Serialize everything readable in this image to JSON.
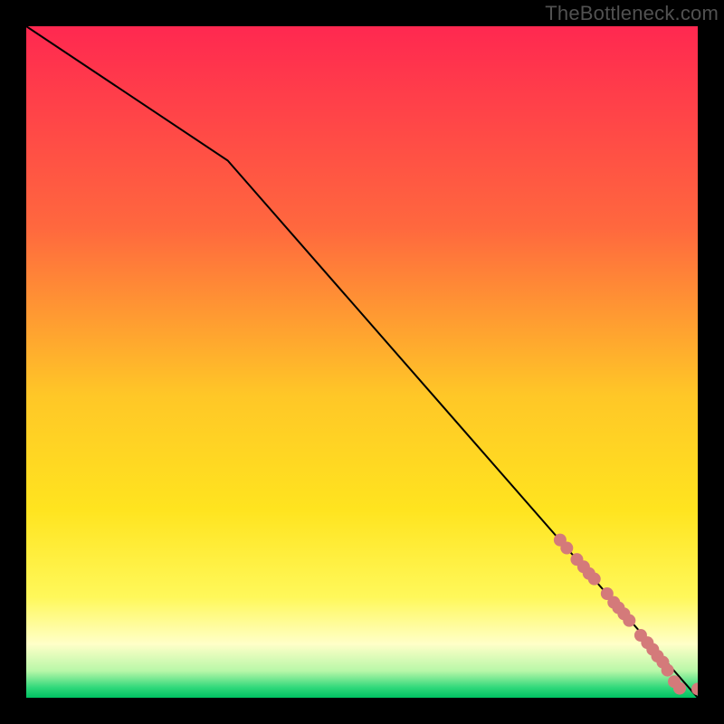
{
  "watermark": "TheBottleneck.com",
  "chart_data": {
    "type": "line",
    "title": "",
    "xlabel": "",
    "ylabel": "",
    "xlim": [
      0,
      100
    ],
    "ylim": [
      0,
      100
    ],
    "background_gradient_stops": [
      {
        "offset": 0.0,
        "color": "#ff2850"
      },
      {
        "offset": 0.3,
        "color": "#ff683e"
      },
      {
        "offset": 0.55,
        "color": "#ffc727"
      },
      {
        "offset": 0.72,
        "color": "#ffe41f"
      },
      {
        "offset": 0.85,
        "color": "#fff85a"
      },
      {
        "offset": 0.92,
        "color": "#ffffc8"
      },
      {
        "offset": 0.96,
        "color": "#b8f7a8"
      },
      {
        "offset": 0.985,
        "color": "#2fd87a"
      },
      {
        "offset": 1.0,
        "color": "#00c262"
      }
    ],
    "series": [
      {
        "name": "trend-line",
        "color": "#000000",
        "stroke_width": 2,
        "x": [
          0,
          30,
          100
        ],
        "y": [
          100,
          80,
          0
        ]
      }
    ],
    "markers": {
      "name": "highlight-points",
      "color": "#d47a7a",
      "radius": 7,
      "points": [
        {
          "x": 79.5,
          "y": 23.5
        },
        {
          "x": 80.5,
          "y": 22.3
        },
        {
          "x": 82.0,
          "y": 20.6
        },
        {
          "x": 83.0,
          "y": 19.5
        },
        {
          "x": 83.8,
          "y": 18.5
        },
        {
          "x": 84.6,
          "y": 17.7
        },
        {
          "x": 86.5,
          "y": 15.5
        },
        {
          "x": 87.5,
          "y": 14.2
        },
        {
          "x": 88.2,
          "y": 13.4
        },
        {
          "x": 89.0,
          "y": 12.5
        },
        {
          "x": 89.8,
          "y": 11.5
        },
        {
          "x": 91.5,
          "y": 9.3
        },
        {
          "x": 92.5,
          "y": 8.2
        },
        {
          "x": 93.3,
          "y": 7.2
        },
        {
          "x": 94.0,
          "y": 6.2
        },
        {
          "x": 94.8,
          "y": 5.3
        },
        {
          "x": 95.5,
          "y": 4.1
        },
        {
          "x": 96.5,
          "y": 2.4
        },
        {
          "x": 97.3,
          "y": 1.4
        },
        {
          "x": 100.0,
          "y": 1.3
        }
      ]
    }
  }
}
